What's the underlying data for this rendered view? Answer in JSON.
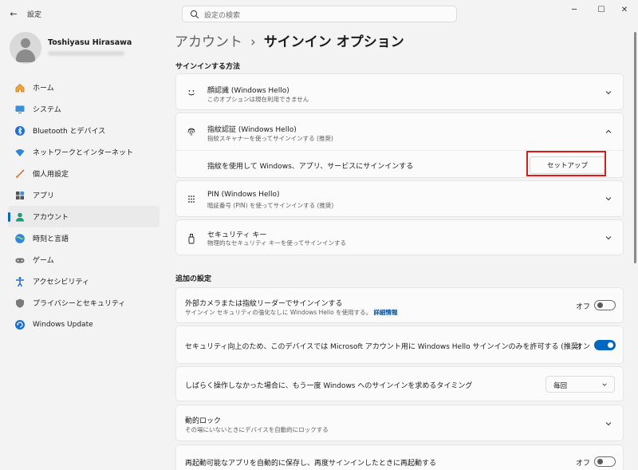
{
  "window": {
    "app_title": "設定",
    "search_placeholder": "設定の検索",
    "minimize": "─",
    "maximize": "☐",
    "close": "✕",
    "back": "←"
  },
  "profile": {
    "name": "Toshiyasu Hirasawa"
  },
  "sidebar": {
    "items": [
      {
        "label": "ホーム",
        "icon": "home-icon"
      },
      {
        "label": "システム",
        "icon": "system-icon"
      },
      {
        "label": "Bluetooth とデバイス",
        "icon": "bluetooth-icon"
      },
      {
        "label": "ネットワークとインターネット",
        "icon": "network-icon"
      },
      {
        "label": "個人用設定",
        "icon": "personalization-icon"
      },
      {
        "label": "アプリ",
        "icon": "apps-icon"
      },
      {
        "label": "アカウント",
        "icon": "account-icon",
        "active": true
      },
      {
        "label": "時刻と言語",
        "icon": "time-language-icon"
      },
      {
        "label": "ゲーム",
        "icon": "gaming-icon"
      },
      {
        "label": "アクセシビリティ",
        "icon": "accessibility-icon"
      },
      {
        "label": "プライバシーとセキュリティ",
        "icon": "privacy-shield-icon"
      },
      {
        "label": "Windows Update",
        "icon": "windows-update-icon"
      }
    ]
  },
  "header": {
    "crumb": "アカウント",
    "separator": "›",
    "current": "サインイン オプション"
  },
  "signin_methods": {
    "section_title": "サインインする方法",
    "face": {
      "title": "顔認識 (Windows Hello)",
      "desc": "このオプションは現在利用できません"
    },
    "fingerprint": {
      "title": "指紋認証 (Windows Hello)",
      "desc": "指紋スキャナーを使ってサインインする (推奨)",
      "detail": "指紋を使用して Windows、アプリ、サービスにサインインする",
      "setup_button": "セットアップ"
    },
    "pin": {
      "title": "PIN (Windows Hello)",
      "desc": "暗証番号 (PIN) を使ってサインインする (推奨)"
    },
    "security_key": {
      "title": "セキュリティ キー",
      "desc": "物理的なセキュリティ キーを使ってサインインする"
    }
  },
  "additional": {
    "section_title": "追加の設定",
    "external_camera": {
      "title": "外部カメラまたは指紋リーダーでサインインする",
      "desc": "サインイン セキュリティの強化なしに Windows Hello を使用する。",
      "link": "詳細情報",
      "state": "オフ"
    },
    "hello_only": {
      "title": "セキュリティ向上のため、このデバイスでは Microsoft アカウント用に Windows Hello サインインのみを許可する (推奨)",
      "state": "オン"
    },
    "away_timing": {
      "title": "しばらく操作しなかった場合に、もう一度 Windows へのサインインを求めるタイミング",
      "value": "毎回"
    },
    "dynamic_lock": {
      "title": "動的ロック",
      "desc": "その場にいないときにデバイスを自動的にロックする"
    },
    "restart_apps": {
      "title": "再起動可能なアプリを自動的に保存し、再度サインインしたときに再起動する",
      "state": "オフ"
    }
  }
}
